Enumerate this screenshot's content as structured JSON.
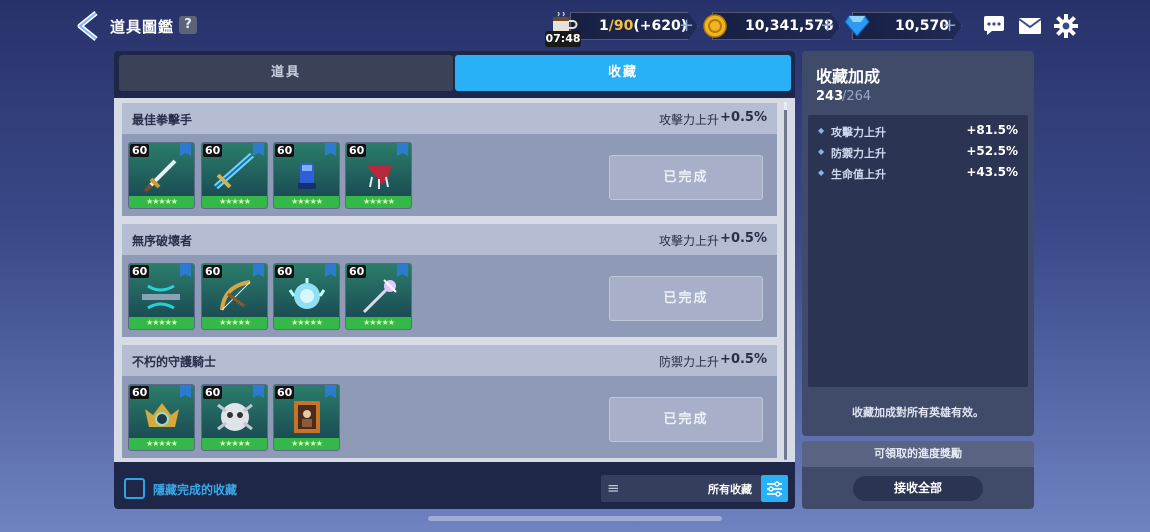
{
  "header": {
    "title": "道具圖鑑",
    "help": "?"
  },
  "resources": {
    "stamina": {
      "current": "1",
      "max": "/90",
      "bonus": "(+620)",
      "timer": "07:48"
    },
    "coins": "10,341,578",
    "gems": "10,570",
    "plus": "+"
  },
  "tabs": [
    {
      "label": "道具",
      "active": false
    },
    {
      "label": "收藏",
      "active": true
    }
  ],
  "collections": [
    {
      "name": "最佳拳擊手",
      "bonus_label": "攻擊力上升",
      "bonus_value": "+0.5%",
      "status": "已完成",
      "items": [
        {
          "level": "60",
          "icon": "sword-icon"
        },
        {
          "level": "60",
          "icon": "greatsword-icon"
        },
        {
          "level": "60",
          "icon": "blue-gauntlet-icon"
        },
        {
          "level": "60",
          "icon": "red-claw-icon"
        }
      ]
    },
    {
      "name": "無序破壞者",
      "bonus_label": "攻擊力上升",
      "bonus_value": "+0.5%",
      "status": "已完成",
      "items": [
        {
          "level": "60",
          "icon": "crossbow-icon"
        },
        {
          "level": "60",
          "icon": "bow-icon"
        },
        {
          "level": "60",
          "icon": "ice-orb-icon"
        },
        {
          "level": "60",
          "icon": "staff-icon"
        }
      ]
    },
    {
      "name": "不朽的守護騎士",
      "bonus_label": "防禦力上升",
      "bonus_value": "+0.5%",
      "status": "已完成",
      "items": [
        {
          "level": "60",
          "icon": "gold-emblem-icon"
        },
        {
          "level": "60",
          "icon": "silver-skull-icon"
        },
        {
          "level": "60",
          "icon": "portrait-frame-icon"
        }
      ]
    }
  ],
  "stars": "★★★★★",
  "footer": {
    "hide_completed": "隱藏完成的收藏",
    "filter_label": "所有收藏"
  },
  "bonus_panel": {
    "title": "收藏加成",
    "count_current": "243",
    "count_total": "/264",
    "stats": [
      {
        "label": "攻擊力上升",
        "value": "+81.5%"
      },
      {
        "label": "防禦力上升",
        "value": "+52.5%"
      },
      {
        "label": "生命值上升",
        "value": "+43.5%"
      }
    ],
    "note": "收藏加成對所有英雄有效。"
  },
  "claim_panel": {
    "title": "可領取的進度獎勵",
    "button": "接收全部"
  },
  "colors": {
    "accent": "#29b1f8",
    "slot_green": "#35b84a"
  }
}
